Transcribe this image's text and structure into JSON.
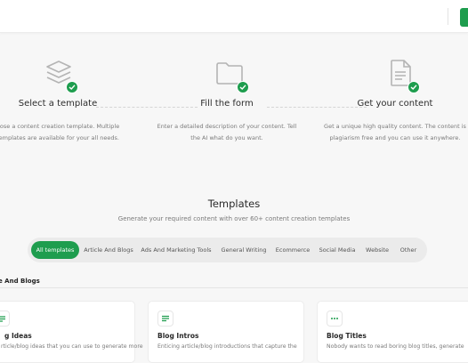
{
  "steps": [
    {
      "title": "Select a template",
      "desc_lines": [
        "pose a content creation template. Multiple",
        "templates are available for your all needs."
      ],
      "icon": "layers-icon"
    },
    {
      "title": "Fill the form",
      "desc_lines": [
        "Enter a detailed description of your content. Tell",
        "the AI what do you want."
      ],
      "icon": "folder-icon"
    },
    {
      "title": "Get your content",
      "desc_lines": [
        "Get a unique high quality content. The content is",
        "plagiarism free and you can use it anywhere."
      ],
      "icon": "document-icon"
    }
  ],
  "templates": {
    "title": "Templates",
    "subtitle": "Generate your required content with over 60+ content creation templates"
  },
  "filters": [
    "All templates",
    "Article And Blogs",
    "Ads And Marketing Tools",
    "General Writing",
    "Ecommerce",
    "Social Media",
    "Website",
    "Other"
  ],
  "active_filter": "All templates",
  "section": {
    "label": "e And Blogs"
  },
  "cards": [
    {
      "title": "g Ideas",
      "desc": "rticle/blog ideas that you can use to generate more",
      "icon": "lines-icon"
    },
    {
      "title": "Blog Intros",
      "desc": "Enticing article/blog introductions that capture the",
      "icon": "lines-icon"
    },
    {
      "title": "Blog Titles",
      "desc": "Nobody wants to read boring blog titles, generate",
      "icon": "dots-icon"
    }
  ],
  "colors": {
    "accent": "#1e9d4e",
    "background": "#f7f7f7",
    "icon_gray": "#b4b4b4"
  }
}
